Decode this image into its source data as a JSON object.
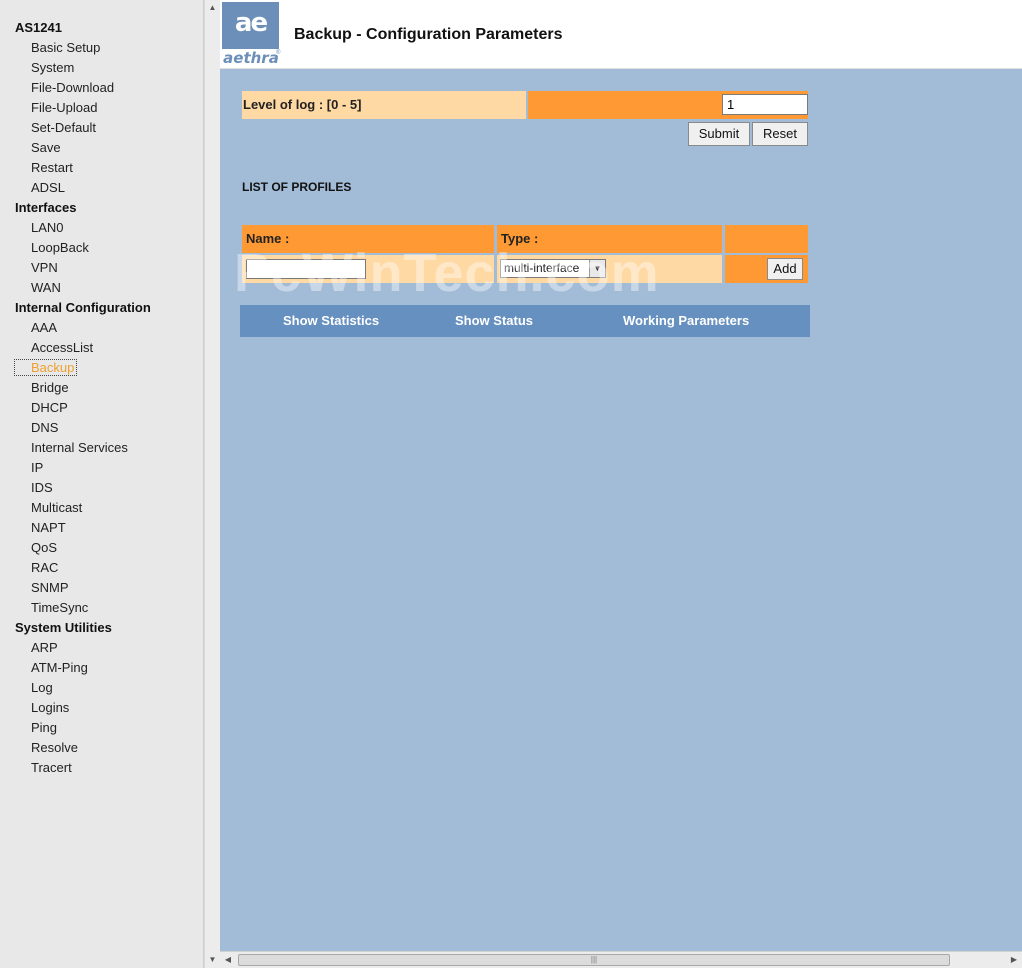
{
  "sidebar": {
    "sections": [
      {
        "title": "AS1241",
        "items": [
          "Basic Setup",
          "System",
          "File-Download",
          "File-Upload",
          "Set-Default",
          "Save",
          "Restart",
          "ADSL"
        ]
      },
      {
        "title": "Interfaces",
        "items": [
          "LAN0",
          "LoopBack",
          "VPN",
          "WAN"
        ]
      },
      {
        "title": "Internal Configuration",
        "items": [
          "AAA",
          "AccessList",
          "Backup",
          "Bridge",
          "DHCP",
          "DNS",
          "Internal Services",
          "IP",
          "IDS",
          "Multicast",
          "NAPT",
          "QoS",
          "RAC",
          "SNMP",
          "TimeSync"
        ]
      },
      {
        "title": "System Utilities",
        "items": [
          "ARP",
          "ATM-Ping",
          "Log",
          "Logins",
          "Ping",
          "Resolve",
          "Tracert"
        ]
      }
    ],
    "active_item": "Backup"
  },
  "header": {
    "logo_text": "aethra",
    "logo_glyph": "ae",
    "title": "Backup - Configuration Parameters"
  },
  "log_level": {
    "label": "Level of log : [0 - 5]",
    "value": "1",
    "submit_label": "Submit",
    "reset_label": "Reset"
  },
  "profiles": {
    "title": "LIST OF PROFILES",
    "col_name": "Name :",
    "col_type": "Type :",
    "name_value": "",
    "type_selected": "multi-interface",
    "add_label": "Add"
  },
  "watermark": "PcWinTech.com",
  "bottom_nav": [
    "Show Statistics",
    "Show Status",
    "Working Parameters"
  ],
  "colors": {
    "content_bg": "#a2bcd8",
    "header_orange": "#ff9933",
    "cell_peach": "#ffd9a3",
    "nav_blue": "#6690bf",
    "logo_blue": "#6b8fb8",
    "active_link": "#f0a030"
  }
}
